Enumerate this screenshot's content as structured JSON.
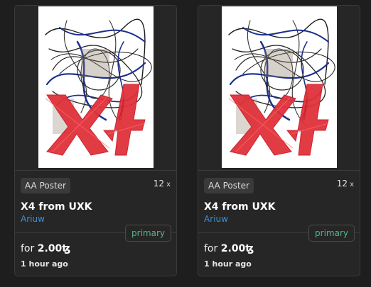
{
  "cards": [
    {
      "badge": "AA Poster",
      "quantity": "12",
      "quantity_suffix": "x",
      "title": "X4 from UXK",
      "author": "Ariuw",
      "tag": "primary",
      "price_prefix": "for",
      "price_value": "2.00",
      "currency_symbol": "ꜩ",
      "time": "1 hour ago"
    },
    {
      "badge": "AA Poster",
      "quantity": "12",
      "quantity_suffix": "x",
      "title": "X4 from UXK",
      "author": "Ariuw",
      "tag": "primary",
      "price_prefix": "for",
      "price_value": "2.00",
      "currency_symbol": "ꜩ",
      "time": "1 hour ago"
    }
  ],
  "colors": {
    "background": "#1e1e1e",
    "card": "#262626",
    "author_link": "#3b8fd6",
    "tag_text": "#52b788",
    "art_red": "#e0313b",
    "art_blue": "#1a2f8f"
  }
}
